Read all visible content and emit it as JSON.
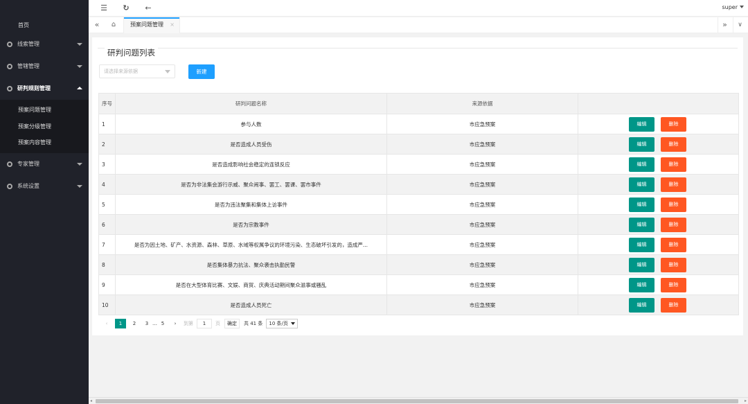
{
  "sidebar": {
    "home": "首页",
    "groups": [
      {
        "label": "线索管理"
      },
      {
        "label": "管辖管理"
      },
      {
        "label": "研判规则管理"
      }
    ],
    "sub_items": [
      "预案问题管理",
      "预案分级管理",
      "预案内容管理"
    ],
    "groups_after": [
      {
        "label": "专家管理"
      },
      {
        "label": "系统设置"
      }
    ]
  },
  "header": {
    "user": "super"
  },
  "tabs": {
    "current": "预案问题管理",
    "close_glyph": "×"
  },
  "card": {
    "title": "研判问题列表",
    "select_placeholder": "请选择来源依据",
    "new_button": "新建"
  },
  "table": {
    "headers": [
      "序号",
      "研判问题名称",
      "来源依据",
      ""
    ],
    "edit_label": "编辑",
    "delete_label": "删除",
    "rows": [
      {
        "seq": "1",
        "name": "参与人数",
        "source": "市应急预案"
      },
      {
        "seq": "2",
        "name": "是否造成人员受伤",
        "source": "市应急预案"
      },
      {
        "seq": "3",
        "name": "是否造成影响社会稳定的连锁反应",
        "source": "市应急预案"
      },
      {
        "seq": "4",
        "name": "是否为非法集会游行示威、聚众闹事、罢工、罢课、罢市事件",
        "source": "市应急预案"
      },
      {
        "seq": "5",
        "name": "是否为违法聚集和集体上访事件",
        "source": "市应急预案"
      },
      {
        "seq": "6",
        "name": "是否为宗教事件",
        "source": "市应急预案"
      },
      {
        "seq": "7",
        "name": "是否为因土地、矿产、水资源、森林、草原、水域等权属争议的环境污染、生态破坏引发的，造成严...",
        "source": "市应急预案"
      },
      {
        "seq": "8",
        "name": "是否集体暴力抗法、聚众袭击执勤民警",
        "source": "市应急预案"
      },
      {
        "seq": "9",
        "name": "是否在大型体育比赛、文娱、商贸、庆典活动期间聚众滋事或骚乱",
        "source": "市应急预案"
      },
      {
        "seq": "10",
        "name": "是否造成人员死亡",
        "source": "市应急预案"
      }
    ]
  },
  "pager": {
    "prev": "‹",
    "pages": [
      "1",
      "2",
      "3",
      "…",
      "5"
    ],
    "next": "›",
    "goto_label": "到第",
    "goto_value": "1",
    "page_unit": "页",
    "confirm": "确定",
    "total": "共 41 条",
    "page_size": "10 条/页"
  },
  "colors": {
    "sidebar_bg": "#20222a",
    "primary_blue": "#1e9fff",
    "edit_green": "#009688",
    "delete_orange": "#ff5722"
  }
}
